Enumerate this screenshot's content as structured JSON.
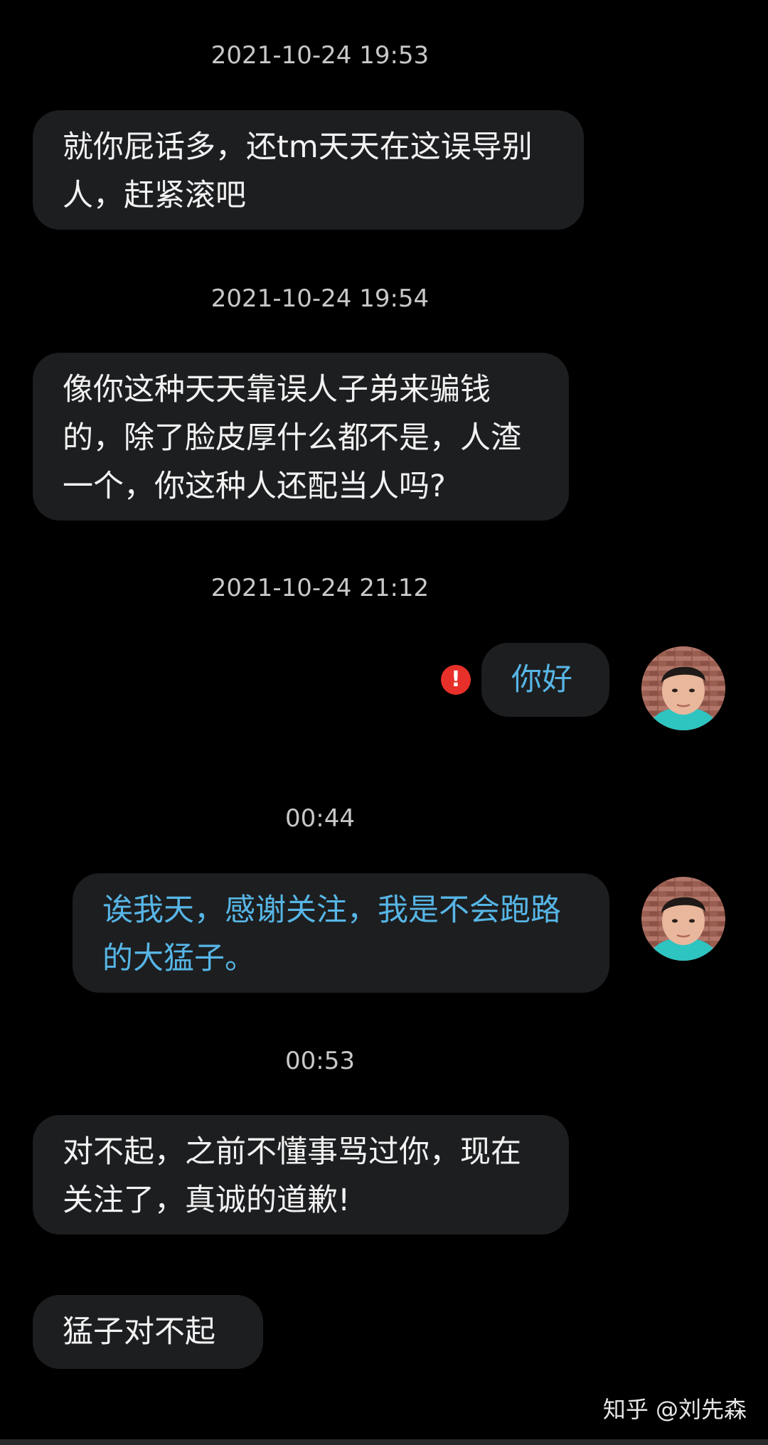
{
  "messages": {
    "ts1": "2021-10-24 19:53",
    "m1": "就你屁话多，还tm天天在这误导别人，赶紧滚吧",
    "ts2": "2021-10-24 19:54",
    "m2": "像你这种天天靠误人子弟来骗钱的，除了脸皮厚什么都不是，人渣一个，你这种人还配当人吗?",
    "ts3": "2021-10-24 21:12",
    "m3": "你好",
    "send_failed_glyph": "!",
    "ts4": "00:44",
    "m4": "诶我天，感谢关注，我是不会跑路的大猛子。",
    "ts5": "00:53",
    "m5": "对不起，之前不懂事骂过你，现在关注了，真诚的道歉!",
    "m6": "猛子对不起"
  },
  "watermark": "知乎 @刘先森",
  "colors": {
    "background": "#000000",
    "bubble": "#1d1e20",
    "incoming_text": "#f2f2f2",
    "outgoing_text": "#57b6e6",
    "timestamp": "#c8c8c8",
    "error": "#e8302a"
  },
  "icons": {
    "send_failed": "exclamation-circle-icon",
    "avatar": "user-avatar"
  }
}
